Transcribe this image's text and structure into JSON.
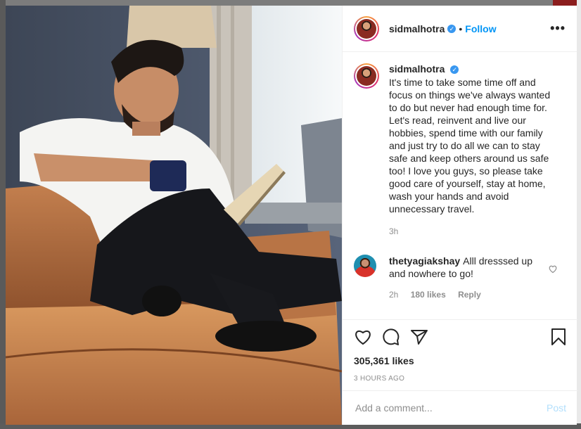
{
  "colors": {
    "accent": "#0095f6",
    "verified": "#3897f0",
    "muted": "#8e8e8e",
    "post_disabled": "#b2dffc"
  },
  "header": {
    "username": "sidmalhotra",
    "verified_icon": "verified-badge-icon",
    "separator": "•",
    "follow_label": "Follow",
    "more_icon": "more-options-icon",
    "more_label": "•••"
  },
  "caption": {
    "username": "sidmalhotra",
    "text": "It's time to take some time off and focus on things we've always wanted to do but never had enough time for. Let's read, reinvent and live our hobbies, spend time with our family and just try to do all we can to stay safe and keep others around us safe too! I love you guys, so please take good care of yourself, stay at home, wash your hands and avoid unnecessary travel.",
    "time_ago": "3h"
  },
  "comments": [
    {
      "username": "thetyagiakshay",
      "text": "Alll dresssed up and nowhere to go!",
      "time_ago": "2h",
      "likes": "180 likes",
      "reply_label": "Reply",
      "like_icon": "heart-outline-icon"
    }
  ],
  "actions": {
    "icons": [
      "heart-outline-icon",
      "comment-bubble-icon",
      "share-paper-plane-icon",
      "bookmark-icon"
    ],
    "likes_count": "305,361 likes",
    "posted_ago": "3 HOURS AGO"
  },
  "composer": {
    "placeholder": "Add a comment...",
    "value": "",
    "post_label": "Post"
  }
}
